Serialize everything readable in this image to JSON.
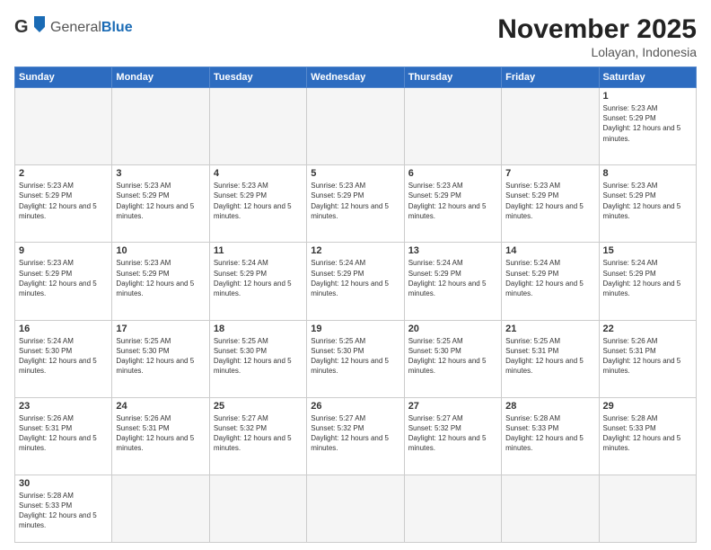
{
  "header": {
    "logo_general": "General",
    "logo_blue": "Blue",
    "month_title": "November 2025",
    "location": "Lolayan, Indonesia"
  },
  "weekdays": [
    "Sunday",
    "Monday",
    "Tuesday",
    "Wednesday",
    "Thursday",
    "Friday",
    "Saturday"
  ],
  "days": {
    "d1": {
      "num": "1",
      "info": "Sunrise: 5:23 AM\nSunset: 5:29 PM\nDaylight: 12 hours and 5 minutes."
    },
    "d2": {
      "num": "2",
      "info": "Sunrise: 5:23 AM\nSunset: 5:29 PM\nDaylight: 12 hours and 5 minutes."
    },
    "d3": {
      "num": "3",
      "info": "Sunrise: 5:23 AM\nSunset: 5:29 PM\nDaylight: 12 hours and 5 minutes."
    },
    "d4": {
      "num": "4",
      "info": "Sunrise: 5:23 AM\nSunset: 5:29 PM\nDaylight: 12 hours and 5 minutes."
    },
    "d5": {
      "num": "5",
      "info": "Sunrise: 5:23 AM\nSunset: 5:29 PM\nDaylight: 12 hours and 5 minutes."
    },
    "d6": {
      "num": "6",
      "info": "Sunrise: 5:23 AM\nSunset: 5:29 PM\nDaylight: 12 hours and 5 minutes."
    },
    "d7": {
      "num": "7",
      "info": "Sunrise: 5:23 AM\nSunset: 5:29 PM\nDaylight: 12 hours and 5 minutes."
    },
    "d8": {
      "num": "8",
      "info": "Sunrise: 5:23 AM\nSunset: 5:29 PM\nDaylight: 12 hours and 5 minutes."
    },
    "d9": {
      "num": "9",
      "info": "Sunrise: 5:23 AM\nSunset: 5:29 PM\nDaylight: 12 hours and 5 minutes."
    },
    "d10": {
      "num": "10",
      "info": "Sunrise: 5:23 AM\nSunset: 5:29 PM\nDaylight: 12 hours and 5 minutes."
    },
    "d11": {
      "num": "11",
      "info": "Sunrise: 5:24 AM\nSunset: 5:29 PM\nDaylight: 12 hours and 5 minutes."
    },
    "d12": {
      "num": "12",
      "info": "Sunrise: 5:24 AM\nSunset: 5:29 PM\nDaylight: 12 hours and 5 minutes."
    },
    "d13": {
      "num": "13",
      "info": "Sunrise: 5:24 AM\nSunset: 5:29 PM\nDaylight: 12 hours and 5 minutes."
    },
    "d14": {
      "num": "14",
      "info": "Sunrise: 5:24 AM\nSunset: 5:29 PM\nDaylight: 12 hours and 5 minutes."
    },
    "d15": {
      "num": "15",
      "info": "Sunrise: 5:24 AM\nSunset: 5:29 PM\nDaylight: 12 hours and 5 minutes."
    },
    "d16": {
      "num": "16",
      "info": "Sunrise: 5:24 AM\nSunset: 5:30 PM\nDaylight: 12 hours and 5 minutes."
    },
    "d17": {
      "num": "17",
      "info": "Sunrise: 5:25 AM\nSunset: 5:30 PM\nDaylight: 12 hours and 5 minutes."
    },
    "d18": {
      "num": "18",
      "info": "Sunrise: 5:25 AM\nSunset: 5:30 PM\nDaylight: 12 hours and 5 minutes."
    },
    "d19": {
      "num": "19",
      "info": "Sunrise: 5:25 AM\nSunset: 5:30 PM\nDaylight: 12 hours and 5 minutes."
    },
    "d20": {
      "num": "20",
      "info": "Sunrise: 5:25 AM\nSunset: 5:30 PM\nDaylight: 12 hours and 5 minutes."
    },
    "d21": {
      "num": "21",
      "info": "Sunrise: 5:25 AM\nSunset: 5:31 PM\nDaylight: 12 hours and 5 minutes."
    },
    "d22": {
      "num": "22",
      "info": "Sunrise: 5:26 AM\nSunset: 5:31 PM\nDaylight: 12 hours and 5 minutes."
    },
    "d23": {
      "num": "23",
      "info": "Sunrise: 5:26 AM\nSunset: 5:31 PM\nDaylight: 12 hours and 5 minutes."
    },
    "d24": {
      "num": "24",
      "info": "Sunrise: 5:26 AM\nSunset: 5:31 PM\nDaylight: 12 hours and 5 minutes."
    },
    "d25": {
      "num": "25",
      "info": "Sunrise: 5:27 AM\nSunset: 5:32 PM\nDaylight: 12 hours and 5 minutes."
    },
    "d26": {
      "num": "26",
      "info": "Sunrise: 5:27 AM\nSunset: 5:32 PM\nDaylight: 12 hours and 5 minutes."
    },
    "d27": {
      "num": "27",
      "info": "Sunrise: 5:27 AM\nSunset: 5:32 PM\nDaylight: 12 hours and 5 minutes."
    },
    "d28": {
      "num": "28",
      "info": "Sunrise: 5:28 AM\nSunset: 5:33 PM\nDaylight: 12 hours and 5 minutes."
    },
    "d29": {
      "num": "29",
      "info": "Sunrise: 5:28 AM\nSunset: 5:33 PM\nDaylight: 12 hours and 5 minutes."
    },
    "d30": {
      "num": "30",
      "info": "Sunrise: 5:28 AM\nSunset: 5:33 PM\nDaylight: 12 hours and 5 minutes."
    }
  }
}
